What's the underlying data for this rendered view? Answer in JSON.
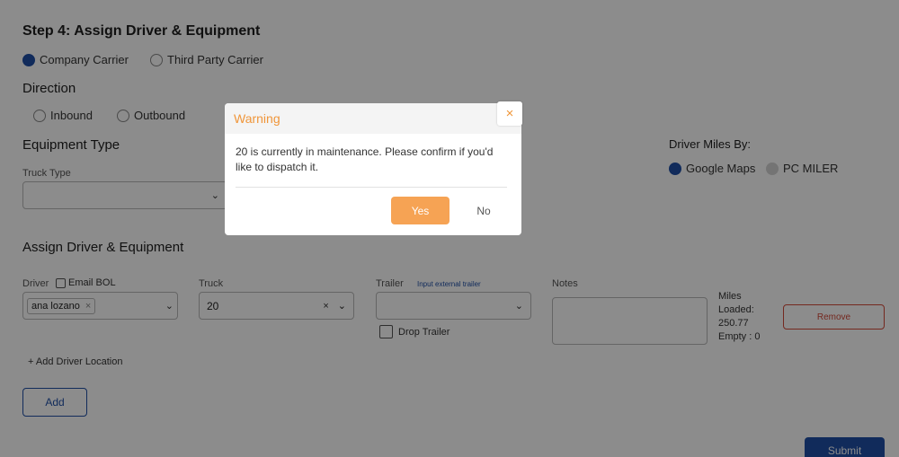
{
  "step": {
    "title": "Step 4: Assign Driver & Equipment"
  },
  "carrier": {
    "options": [
      "Company Carrier",
      "Third Party Carrier"
    ],
    "selected": "Company Carrier"
  },
  "direction": {
    "title": "Direction",
    "options": [
      "Inbound",
      "Outbound"
    ]
  },
  "equipment": {
    "title": "Equipment Type",
    "truck_type_label": "Truck Type",
    "truck_type_value": ""
  },
  "driver_miles": {
    "title": "Driver Miles By:",
    "options": [
      "Google Maps",
      "PC MILER"
    ],
    "selected": "Google Maps"
  },
  "assign": {
    "title": "Assign Driver & Equipment",
    "driver_label": "Driver",
    "email_bol_label": "Email BOL",
    "driver_chip": "ana lozano",
    "truck_label": "Truck",
    "truck_value": "20",
    "trailer_label": "Trailer",
    "external_trailer_link": "Input external trailer",
    "drop_trailer_label": "Drop Trailer",
    "notes_label": "Notes",
    "miles_label": "Miles",
    "loaded_label": "Loaded:",
    "loaded_value": "250.77",
    "empty_label": "Empty : 0",
    "remove_button": "Remove",
    "add_location": "+ Add Driver Location",
    "add_button": "Add",
    "submit_button": "Submit"
  },
  "modal": {
    "title": "Warning",
    "close_glyph": "×",
    "message": "20 is currently in maintenance. Please confirm if you'd like to dispatch it.",
    "yes_button": "Yes",
    "no_button": "No"
  },
  "colors": {
    "accent": "#1f4fa6",
    "warning": "#f0963a",
    "yes_button": "#f6a354",
    "remove": "#c0392b"
  }
}
